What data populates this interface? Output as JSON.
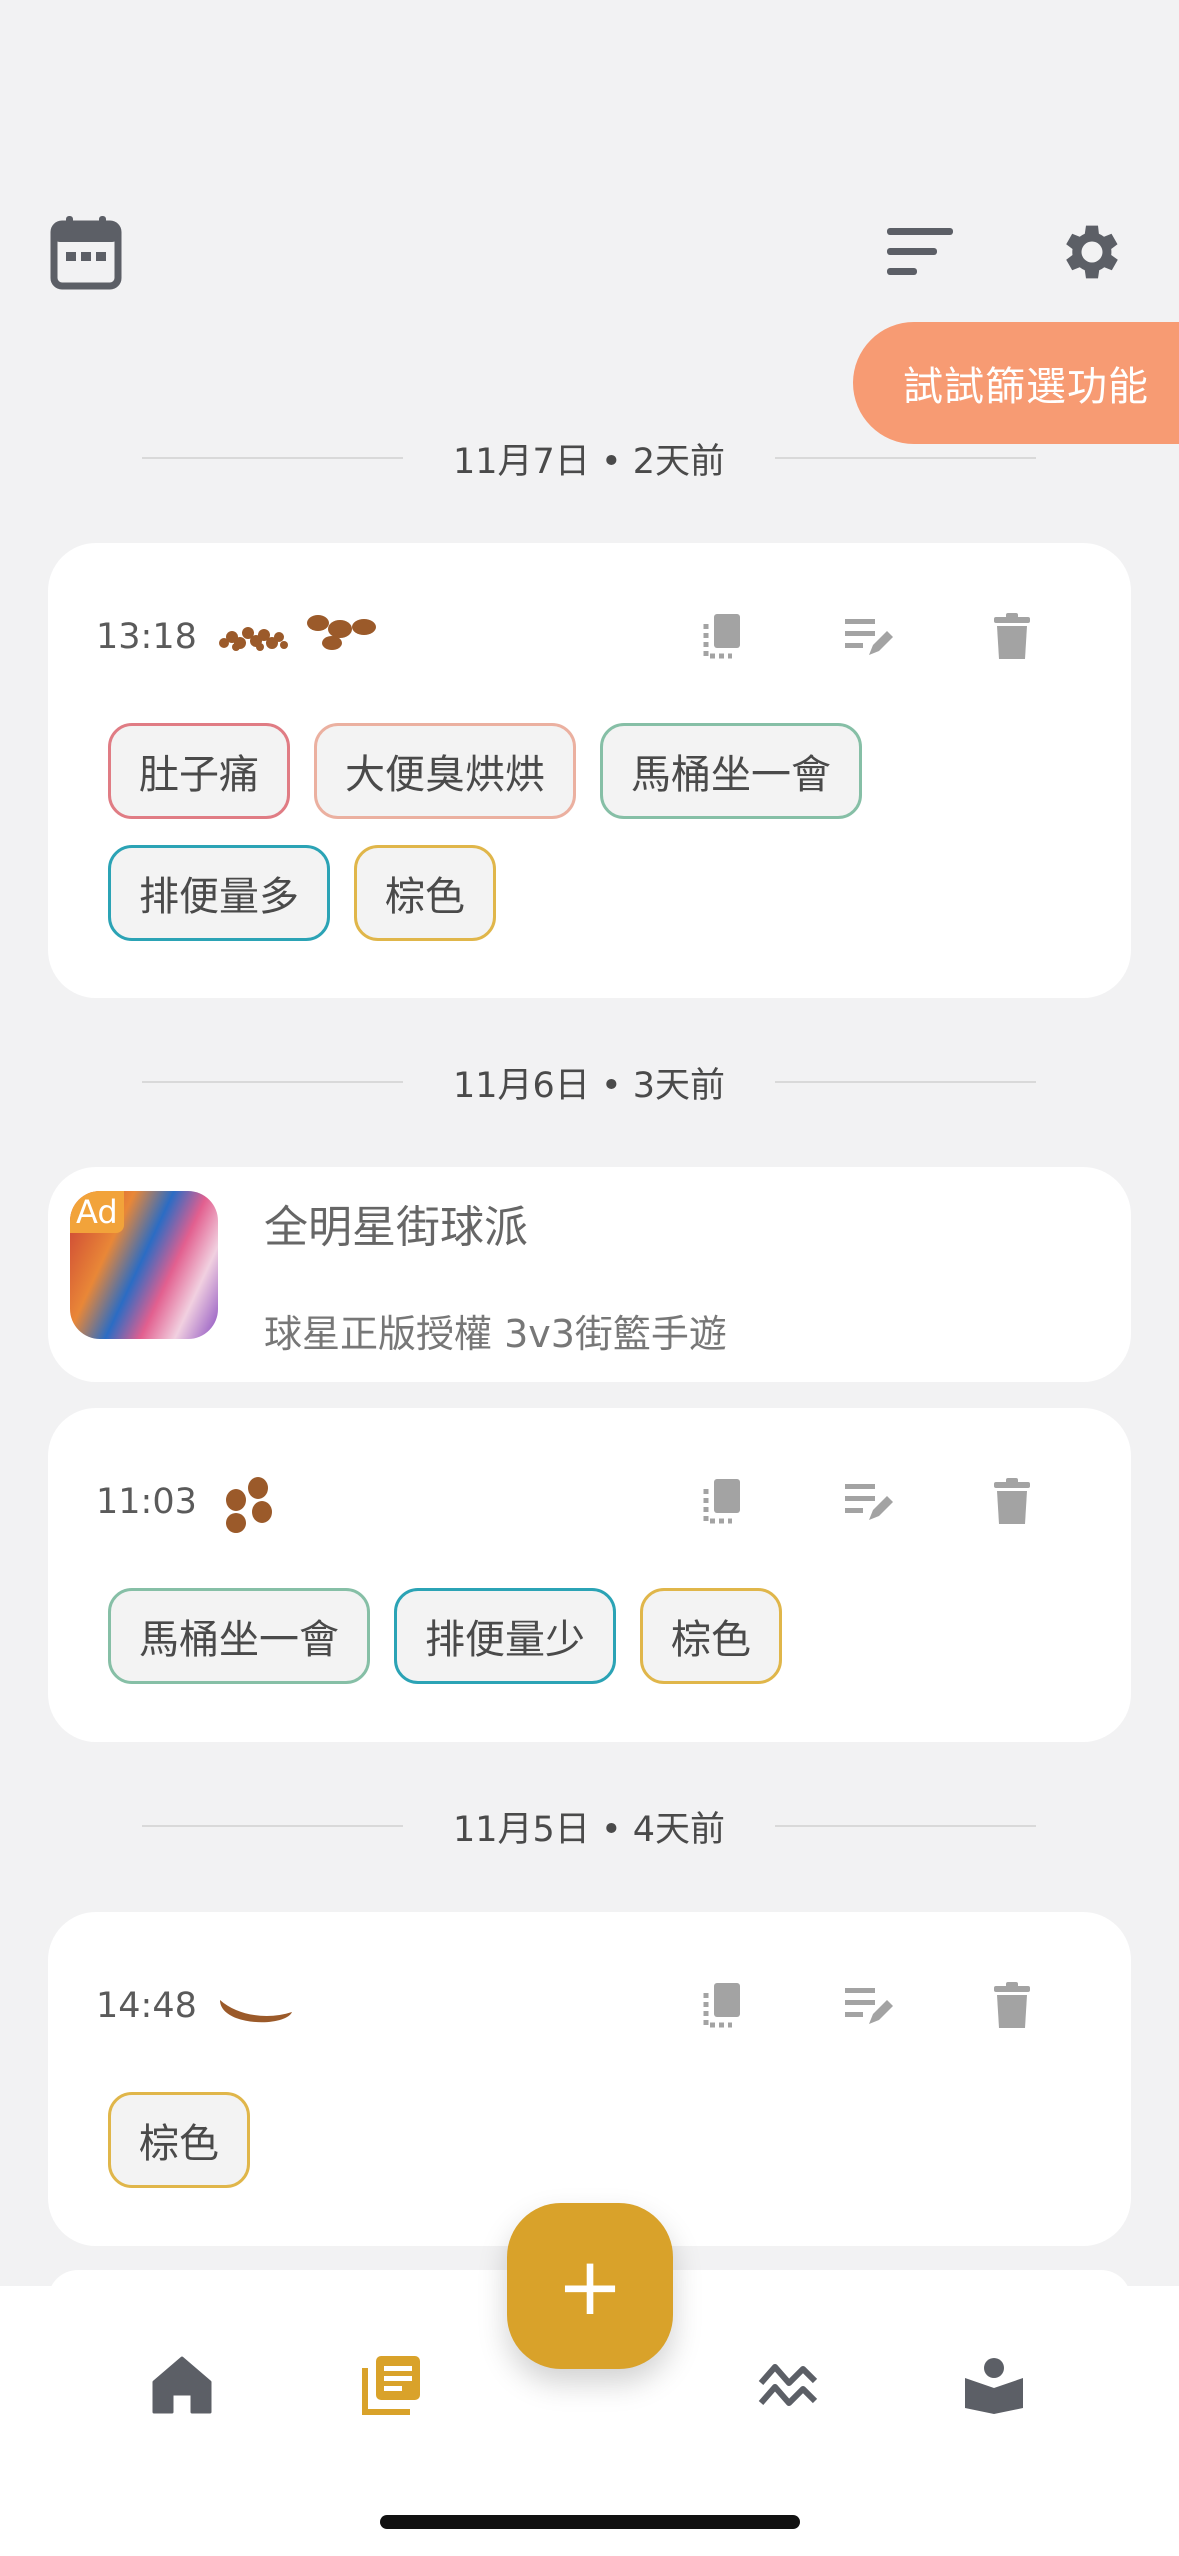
{
  "header": {
    "calendar_icon": "calendar-icon",
    "filter_icon": "filter-lines-icon",
    "settings_icon": "gear-icon",
    "tooltip": "試試篩選功能",
    "tooltip_color": "#f79b73"
  },
  "groups": [
    {
      "date_label": "11月7日 • 2天前"
    },
    {
      "date_label": "11月6日 • 3天前"
    },
    {
      "date_label": "11月5日 • 4天前"
    }
  ],
  "entries": [
    {
      "time": "13:18",
      "stool_icons": [
        "crumbly-stool-icon",
        "chunk-stool-icon"
      ],
      "tags": [
        {
          "label": "肚子痛",
          "color": "#e07c84"
        },
        {
          "label": "大便臭烘烘",
          "color": "#ebb0a0"
        },
        {
          "label": "馬桶坐一會",
          "color": "#86bfa6"
        },
        {
          "label": "排便量多",
          "color": "#2ba3b5"
        },
        {
          "label": "棕色",
          "color": "#e0b64a"
        }
      ]
    },
    {
      "time": "11:03",
      "stool_icons": [
        "pellet-stool-icon"
      ],
      "tags": [
        {
          "label": "馬桶坐一會",
          "color": "#86bfa6"
        },
        {
          "label": "排便量少",
          "color": "#2ba3b5"
        },
        {
          "label": "棕色",
          "color": "#e0b64a"
        }
      ]
    },
    {
      "time": "14:48",
      "stool_icons": [
        "smooth-stool-icon"
      ],
      "tags": [
        {
          "label": "棕色",
          "color": "#e0b64a"
        }
      ]
    }
  ],
  "ad": {
    "badge": "Ad",
    "title": "全明星街球派",
    "subtitle": "球星正版授權 3v3街籃手遊"
  },
  "actions": [
    "copy-icon",
    "edit-icon",
    "trash-icon"
  ],
  "fab": {
    "label": "+",
    "color": "#d9a22a"
  },
  "bottom_nav": [
    "home-icon",
    "records-icon",
    "trend-icon",
    "learn-book-icon"
  ],
  "accent": "#d9a22a"
}
